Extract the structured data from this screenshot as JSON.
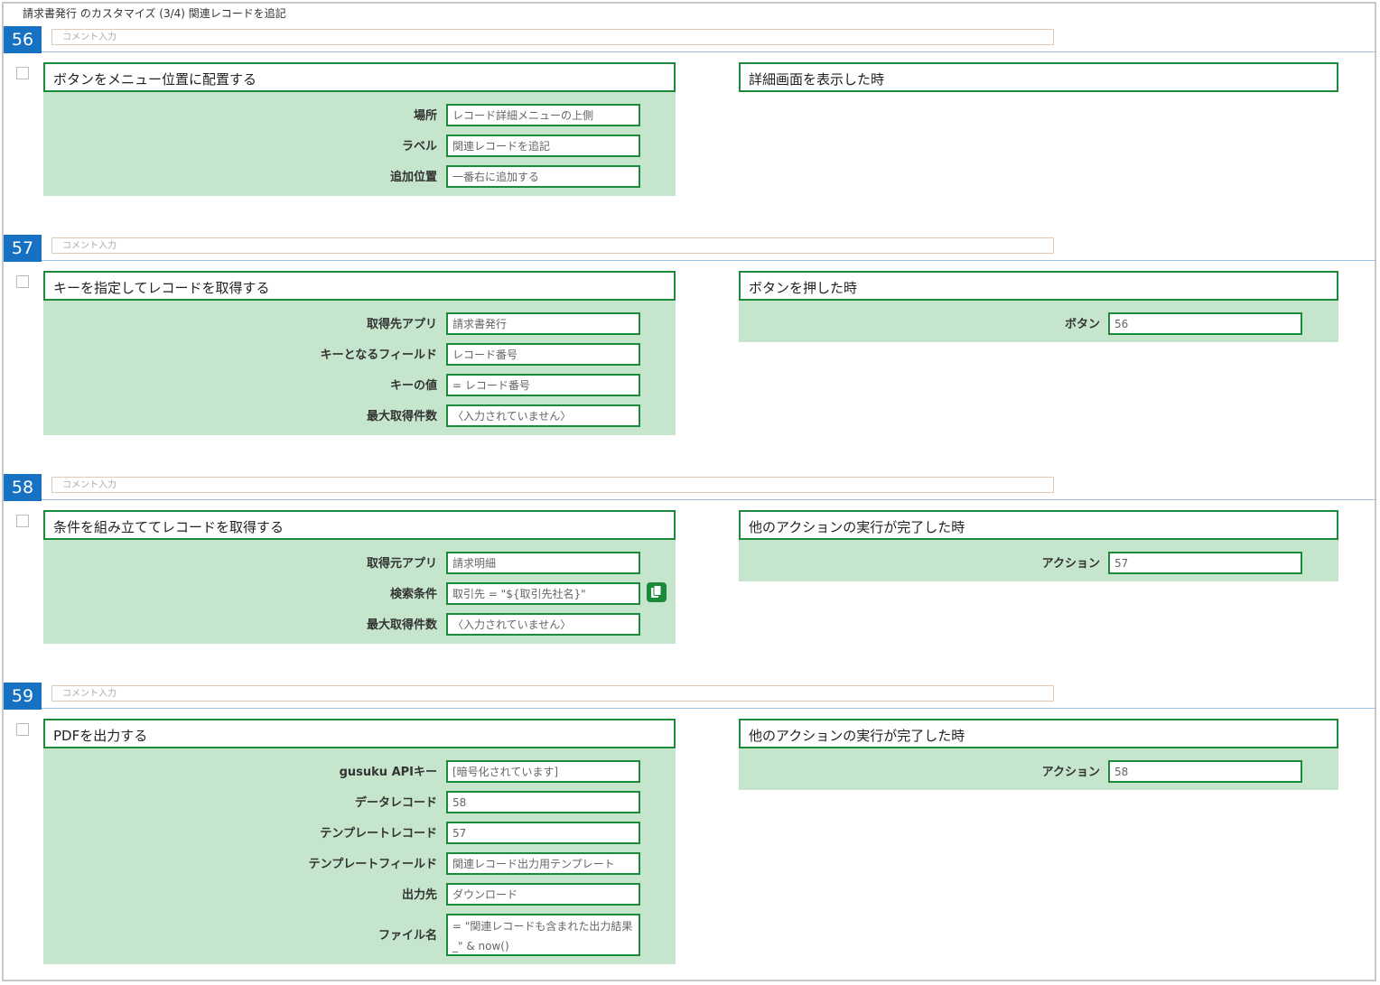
{
  "page_title": "請求書発行 のカスタマイズ (3/4) 関連レコードを追記",
  "comment_placeholder": "コメント入力",
  "blocks": [
    {
      "number": "56",
      "action": {
        "title": "ボタンをメニュー位置に配置する",
        "fields": [
          {
            "label": "場所",
            "value": "レコード詳細メニューの上側"
          },
          {
            "label": "ラベル",
            "value": "関連レコードを追記"
          },
          {
            "label": "追加位置",
            "value": "一番右に追加する"
          }
        ]
      },
      "trigger": {
        "title": "詳細画面を表示した時",
        "fields": []
      }
    },
    {
      "number": "57",
      "action": {
        "title": "キーを指定してレコードを取得する",
        "fields": [
          {
            "label": "取得先アプリ",
            "value": "請求書発行"
          },
          {
            "label": "キーとなるフィールド",
            "value": "レコード番号"
          },
          {
            "label": "キーの値",
            "value": "= レコード番号"
          },
          {
            "label": "最大取得件数",
            "value": "〈入力されていません〉"
          }
        ]
      },
      "trigger": {
        "title": "ボタンを押した時",
        "fields": [
          {
            "label": "ボタン",
            "value": "56"
          }
        ]
      }
    },
    {
      "number": "58",
      "action": {
        "title": "条件を組み立ててレコードを取得する",
        "fields": [
          {
            "label": "取得元アプリ",
            "value": "請求明細"
          },
          {
            "label": "検索条件",
            "value": "取引先 = \"${取引先社名}\""
          },
          {
            "label": "最大取得件数",
            "value": "〈入力されていません〉"
          }
        ]
      },
      "trigger": {
        "title": "他のアクションの実行が完了した時",
        "fields": [
          {
            "label": "アクション",
            "value": "57"
          }
        ]
      }
    },
    {
      "number": "59",
      "action": {
        "title": "PDFを出力する",
        "fields": [
          {
            "label": "gusuku APIキー",
            "value": "[暗号化されています]"
          },
          {
            "label": "データレコード",
            "value": "58"
          },
          {
            "label": "テンプレートレコード",
            "value": "57"
          },
          {
            "label": "テンプレートフィールド",
            "value": "関連レコード出力用テンプレート"
          },
          {
            "label": "出力先",
            "value": "ダウンロード"
          },
          {
            "label": "ファイル名",
            "value": "= \"関連レコードも含まれた出力結果_\" & now()"
          }
        ]
      },
      "trigger": {
        "title": "他のアクションの実行が完了した時",
        "fields": [
          {
            "label": "アクション",
            "value": "58"
          }
        ]
      }
    }
  ],
  "icons": {
    "copy": "copy-icon"
  },
  "colors": {
    "number_badge": "#1771c3",
    "panel_border": "#1b8a3b",
    "panel_fill": "#c5e6cd"
  }
}
